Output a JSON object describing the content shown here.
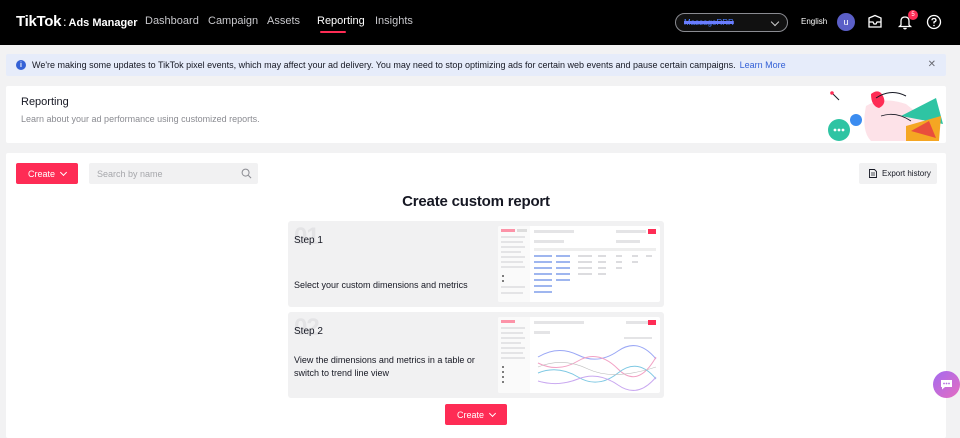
{
  "topbar": {
    "brand": "TikTok",
    "separator": ":",
    "product": "Ads Manager",
    "nav": [
      "Dashboard",
      "Campaign",
      "Assets",
      "Reporting",
      "Insights"
    ],
    "active_nav": "Reporting",
    "account_name": "MassageRRR",
    "language": "English",
    "avatar_initial": "u",
    "notification_count": "5"
  },
  "notice": {
    "message": "We're making some updates to TikTok pixel events, which may affect your ad delivery. You may need to stop optimizing ads for certain web events and pause certain campaigns.",
    "link": "Learn More"
  },
  "header": {
    "title": "Reporting",
    "subtitle": "Learn about your ad performance using customized reports."
  },
  "toolbar": {
    "create_label": "Create",
    "search_placeholder": "Search by name",
    "export_label": "Export history"
  },
  "main": {
    "heading": "Create custom report",
    "steps": [
      {
        "number": "01",
        "label": "Step 1",
        "description": "Select your custom dimensions and metrics"
      },
      {
        "number": "02",
        "label": "Step 2",
        "description": "View the dimensions and metrics in a table or switch to trend line view"
      }
    ],
    "create_label": "Create"
  },
  "colors": {
    "accent": "#fe2c55",
    "link": "#3461d6",
    "topbar": "#000000",
    "banner": "#e6ecfa"
  }
}
